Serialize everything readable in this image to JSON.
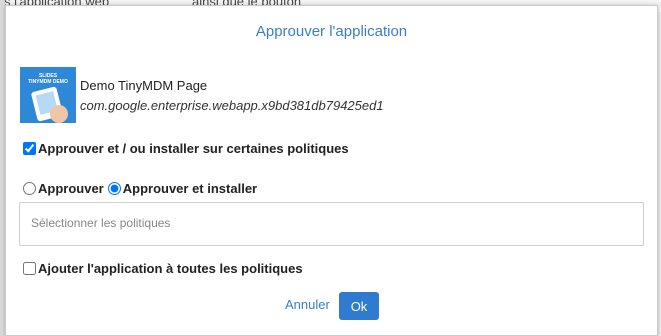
{
  "background": {
    "text_left": "s l'application web",
    "text_right": "ainsi que le bouton"
  },
  "dialog": {
    "title": "Approuver l'application",
    "app": {
      "name": "Demo TinyMDM Page",
      "package_id": "com.google.enterprise.webapp.x9bd381db79425ed1",
      "icon_text": "SLIDES TINYMDM DEMO"
    },
    "approve_policies_checkbox": {
      "label": "Approuver et / ou installer sur certaines politiques",
      "checked": true
    },
    "mode_radios": [
      {
        "label": "Approuver",
        "selected": false
      },
      {
        "label": "Approuver et installer",
        "selected": true
      }
    ],
    "policy_select": {
      "placeholder": "Sélectionner les politiques"
    },
    "add_all_checkbox": {
      "label": "Ajouter l'application à toutes les politiques",
      "checked": false
    },
    "buttons": {
      "cancel": "Annuler",
      "ok": "Ok"
    }
  },
  "colors": {
    "accent": "#3a7ecf",
    "ok_button": "#2f7bd0",
    "app_icon_bg": "#2f88d6"
  }
}
